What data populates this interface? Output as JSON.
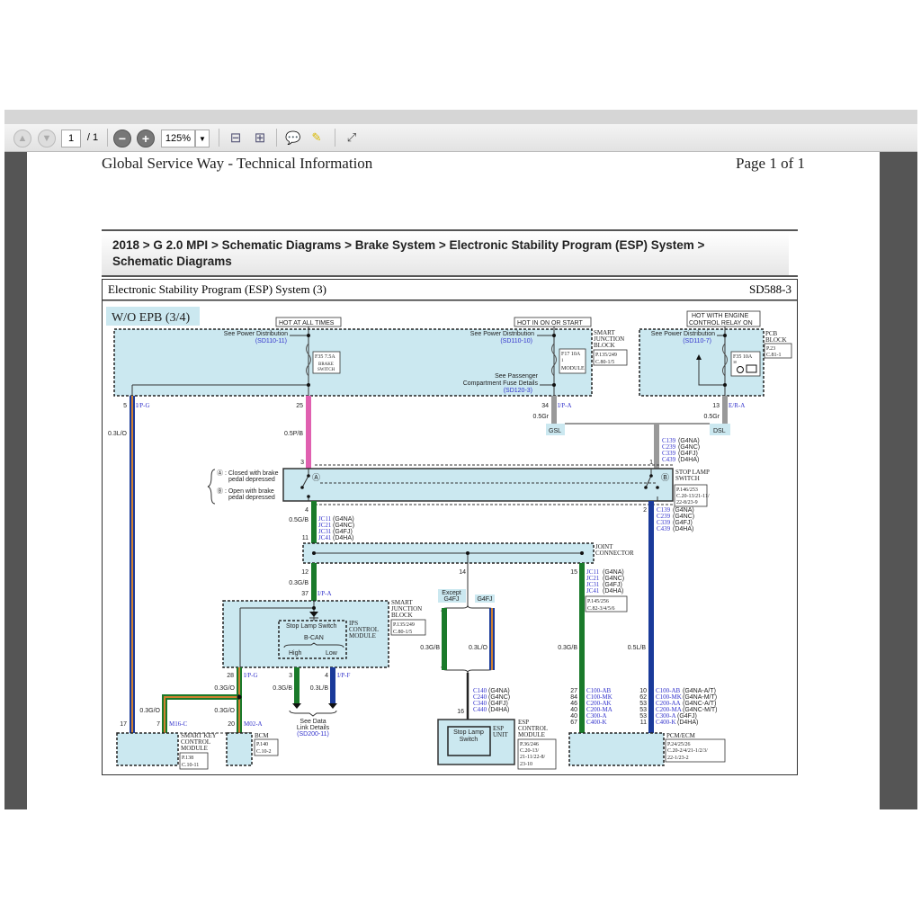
{
  "toolbar": {
    "page_current": "1",
    "page_total": "/ 1",
    "zoom": "125%",
    "icons": [
      "arrow-up-icon",
      "arrow-down-icon",
      "zoom-out-icon",
      "zoom-in-icon",
      "fit-page-icon",
      "fit-width-icon",
      "comment-icon",
      "highlight-icon",
      "fullscreen-icon"
    ]
  },
  "header": {
    "left": "Global Service Way - Technical Information",
    "right": "Page 1 of 1"
  },
  "breadcrumb": {
    "line1": "2018 > G 2.0 MPI > Schematic Diagrams > Brake System > Electronic Stability Program (ESP) System >",
    "line2": "Schematic Diagrams"
  },
  "title": {
    "name": "Electronic Stability Program (ESP) System (3)",
    "code": "SD588-3"
  },
  "colors": {
    "block_fill": "#cbe8f0",
    "link": "#3333cc",
    "wire_pink": "#e060b0",
    "wire_green": "#1a7a2a",
    "wire_blue": "#1a3a9a",
    "wire_gray": "#999999",
    "wire_orange": "#d08030",
    "wire_yellowgreen": "#7aa020"
  },
  "diagram": {
    "variant": "W/O EPB (3/4)",
    "hot1": "HOT AT ALL TIMES",
    "hot2": "HOT IN ON OR START",
    "hot3a": "HOT WITH ENGINE",
    "hot3b": "CONTROL RELAY ON",
    "see_pd": "See Power Distribution",
    "sd110_11": "(SD110-11)",
    "sd110_10": "(SD110-10)",
    "sd110_7": "(SD110-7)",
    "f35a": "F35 7.5A",
    "f35b": "BRAKE",
    "f35c": "SWITCH",
    "f17a": "F17 10A",
    "f17b": "1",
    "f17c": "MODULE",
    "f35r": "F35 10A",
    "f35r2": "30",
    "pass1": "See Passenger",
    "pass2": "Compartment Fuse Details",
    "pass3": "(SD120-3)",
    "sjb": [
      "SMART",
      "JUNCTION",
      "BLOCK"
    ],
    "sjb_ref": [
      "P.135/249",
      "C.80-1/5"
    ],
    "pcb": [
      "PCB",
      "BLOCK"
    ],
    "pcb_ref": [
      "P.23",
      "C.81-1"
    ],
    "pin5": "5",
    "ipg": "I/P-G",
    "w03lo": "0.3L/O",
    "pin25": "25",
    "w05pb": "0.5P/B",
    "pin34": "34",
    "ipa": "I/P-A",
    "w05gr": "0.5Gr",
    "gsl": "GSL",
    "pin13": "13",
    "era": "E/R-A",
    "dsl": "DSL",
    "c139": [
      [
        "C139",
        "(G4NA)"
      ],
      [
        "C239",
        "(G4NC)"
      ],
      [
        "C339",
        "(G4FJ)"
      ],
      [
        "C439",
        "(D4HA)"
      ]
    ],
    "pin3": "3",
    "pin1": "1",
    "pin4": "4",
    "pin2": "2",
    "pin11": "11",
    "pin12": "12",
    "pin14": "14",
    "pin15": "15",
    "pin37": "37",
    "legendA": [
      "Ⓐ : Closed with brake",
      "pedal depressed"
    ],
    "legendB": [
      "Ⓑ : Open with brake",
      "pedal depressed"
    ],
    "circA": "Ⓐ",
    "circB": "Ⓑ",
    "sls": [
      "STOP LAMP",
      "SWITCH"
    ],
    "sls_ref": [
      "P.146/253",
      "C.20-13/21-11/",
      "22-8/23-9"
    ],
    "w05gb": "0.5G/B",
    "jc": [
      [
        "JC11",
        "(G4NA)"
      ],
      [
        "JC21",
        "(G4NC)"
      ],
      [
        "JC31",
        "(G4FJ)"
      ],
      [
        "JC41",
        "(D4HA)"
      ]
    ],
    "joint": [
      "JOINT",
      "CONNECTOR"
    ],
    "joint_ref": [
      "P.145/256",
      "C.82-3/4/5/6"
    ],
    "w03gb": "0.3G/B",
    "w03lb": "0.3L/B",
    "w03go": "0.3G/O",
    "w05lb": "0.5L/B",
    "ips_sls": "Stop Lamp Switch",
    "bcan": "B-CAN",
    "high": "High",
    "low": "Low",
    "ips": [
      "IPS",
      "CONTROL",
      "MODULE"
    ],
    "pin28": "28",
    "ipf": "I/P-F",
    "pin17": "17",
    "pin7": "7",
    "m16c": "M16-C",
    "pin20": "20",
    "m02a": "M02-A",
    "dl": [
      "See Data",
      "Link Details",
      "(SD200-11)"
    ],
    "skm": [
      "SMART KEY",
      "CONTROL",
      "MODULE"
    ],
    "skm_ref": [
      "P.138",
      "C.10-11"
    ],
    "bcm": "BCM",
    "bcm_ref": [
      "P.140",
      "C.10-2"
    ],
    "except": [
      "Except",
      "G4FJ"
    ],
    "g4fj": "G4FJ",
    "c140": [
      [
        "C140",
        "(G4NA)"
      ],
      [
        "C240",
        "(G4NC)"
      ],
      [
        "C340",
        "(G4FJ)"
      ],
      [
        "C440",
        "(D4HA)"
      ]
    ],
    "pin16": "16",
    "esp_sls": [
      "Stop Lamp",
      "Switch"
    ],
    "esp_unit": [
      "ESP",
      "UNIT"
    ],
    "esp": [
      "ESP",
      "CONTROL",
      "MODULE"
    ],
    "esp_ref": [
      "P.36/246",
      "C.20-13/",
      "21-11/22-8/",
      "23-10"
    ],
    "pcm_left": [
      [
        "27",
        "C100-AB"
      ],
      [
        "84",
        "C100-MK"
      ],
      [
        "46",
        "C200-AK"
      ],
      [
        "40",
        "C200-MA"
      ],
      [
        "40",
        "C300-A"
      ],
      [
        "67",
        "C400-K"
      ]
    ],
    "pcm_right": [
      [
        "10",
        "C100-AB",
        "(G4NA-A/T)"
      ],
      [
        "62",
        "C100-MK",
        "(G4NA-M/T)"
      ],
      [
        "53",
        "C200-AA",
        "(G4NC-A/T)"
      ],
      [
        "53",
        "C200-MA",
        "(G4NC-M/T)"
      ],
      [
        "53",
        "C300-A",
        "(G4FJ)"
      ],
      [
        "11",
        "C400-K",
        "(D4HA)"
      ]
    ],
    "pcm": "PCM/ECM",
    "pcm_ref": [
      "P.24/25/26",
      "C.20-2/4/21-1/2/3/",
      "22-1/23-2"
    ]
  }
}
